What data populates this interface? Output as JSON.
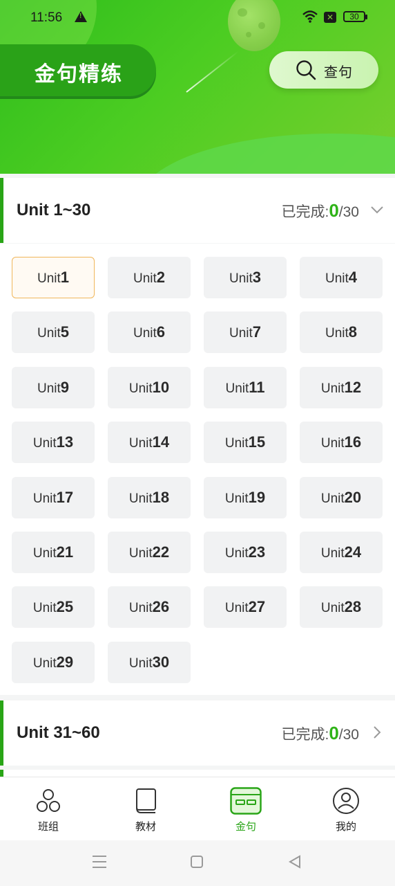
{
  "status_bar": {
    "time": "11:56",
    "battery": "30"
  },
  "header": {
    "title": "金句精练",
    "search_label": "查句"
  },
  "sections": [
    {
      "name": "Unit 1~30",
      "progress_label": "已完成:",
      "completed": "0",
      "total": "/30",
      "expanded": true,
      "unit_prefix": "Unit",
      "selected_unit": "1",
      "units": [
        "1",
        "2",
        "3",
        "4",
        "5",
        "6",
        "7",
        "8",
        "9",
        "10",
        "11",
        "12",
        "13",
        "14",
        "15",
        "16",
        "17",
        "18",
        "19",
        "20",
        "21",
        "22",
        "23",
        "24",
        "25",
        "26",
        "27",
        "28",
        "29",
        "30"
      ]
    },
    {
      "name": "Unit 31~60",
      "progress_label": "已完成:",
      "completed": "0",
      "total": "/30",
      "expanded": false
    }
  ],
  "tabbar": {
    "items": [
      {
        "label": "班组",
        "icon": "group-icon"
      },
      {
        "label": "教材",
        "icon": "book-icon"
      },
      {
        "label": "金句",
        "icon": "sentence-card-icon",
        "active": true
      },
      {
        "label": "我的",
        "icon": "profile-icon"
      }
    ]
  },
  "colors": {
    "brand_green": "#29a516",
    "accent_orange": "#f0b65a"
  }
}
